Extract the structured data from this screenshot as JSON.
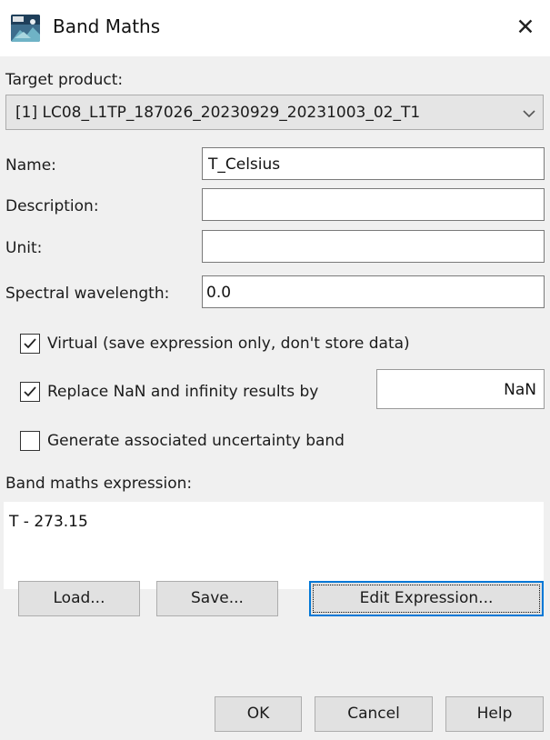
{
  "window": {
    "title": "Band Maths",
    "close_glyph": "✕",
    "icon": "snap-app-icon"
  },
  "form": {
    "target_product_label": "Target product:",
    "target_product_value": "[1] LC08_L1TP_187026_20230929_20231003_02_T1",
    "name_label": "Name:",
    "name_value": "T_Celsius",
    "description_label": "Description:",
    "description_value": "",
    "unit_label": "Unit:",
    "unit_value": "",
    "wavelength_label": "Spectral wavelength:",
    "wavelength_value": "0.0"
  },
  "options": {
    "virtual_label": "Virtual (save expression only, don't store data)",
    "virtual_checked": true,
    "replace_nan_label": "Replace NaN and infinity results by",
    "replace_nan_checked": true,
    "replace_nan_value": "NaN",
    "uncertainty_label": "Generate associated uncertainty band",
    "uncertainty_checked": false
  },
  "expression": {
    "label": "Band maths expression:",
    "value": "T - 273.15"
  },
  "buttons": {
    "load": "Load...",
    "save": "Save...",
    "edit_expression": "Edit Expression...",
    "ok": "OK",
    "cancel": "Cancel",
    "help": "Help"
  },
  "colors": {
    "dialog_bg": "#f0f0f0",
    "button_bg": "#e1e1e1",
    "focus_accent": "#0078d7"
  }
}
